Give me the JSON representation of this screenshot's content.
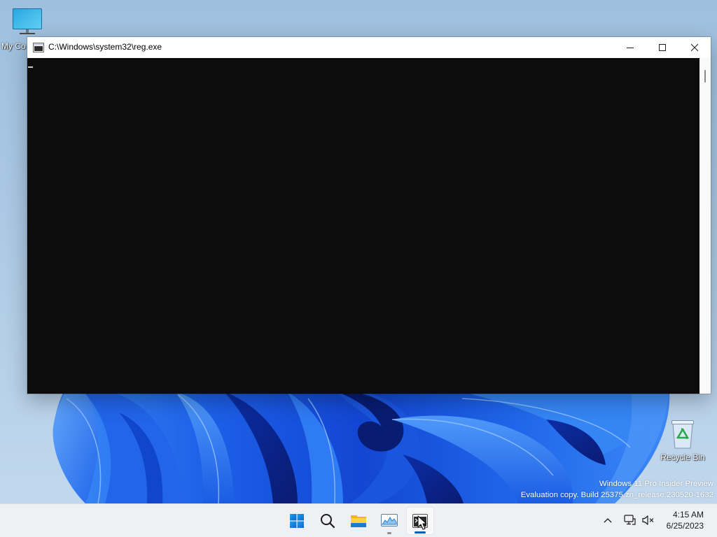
{
  "theme": {
    "accent": "#005fb8",
    "console_background": "#0c0c0c",
    "taskbar_background": "#eef0f3",
    "start_logo": "#0a78e0"
  },
  "desktop": {
    "icons": [
      {
        "label": "My Co",
        "icon": "computer-icon"
      },
      {
        "label": "Recycle Bin",
        "icon": "recycle-bin-icon"
      }
    ],
    "watermark": {
      "line1": "Windows 11 Pro Insider Preview",
      "line2": "Evaluation copy. Build 25375.zn_release.230520-1632"
    }
  },
  "console_window": {
    "title": "C:\\Windows\\system32\\reg.exe",
    "app_icon": "console-icon",
    "buttons": [
      "minimize-icon",
      "maximize-icon",
      "close-icon"
    ],
    "scroll_position": 0
  },
  "taskbar": {
    "items": [
      {
        "icon": "windows-start-icon",
        "running": false,
        "active": false
      },
      {
        "icon": "search-icon",
        "running": false,
        "active": false
      },
      {
        "icon": "file-explorer-icon",
        "running": false,
        "active": false
      },
      {
        "icon": "performance-monitor-icon",
        "running": true,
        "active": false
      },
      {
        "icon": "console-icon",
        "running": true,
        "active": true
      }
    ],
    "tray": {
      "icons": [
        "chevron-up-icon",
        "network-icon",
        "volume-muted-icon"
      ],
      "time": "4:15 AM",
      "date": "6/25/2023"
    }
  },
  "pointer": {
    "icon": "mouse-pointer-icon"
  }
}
